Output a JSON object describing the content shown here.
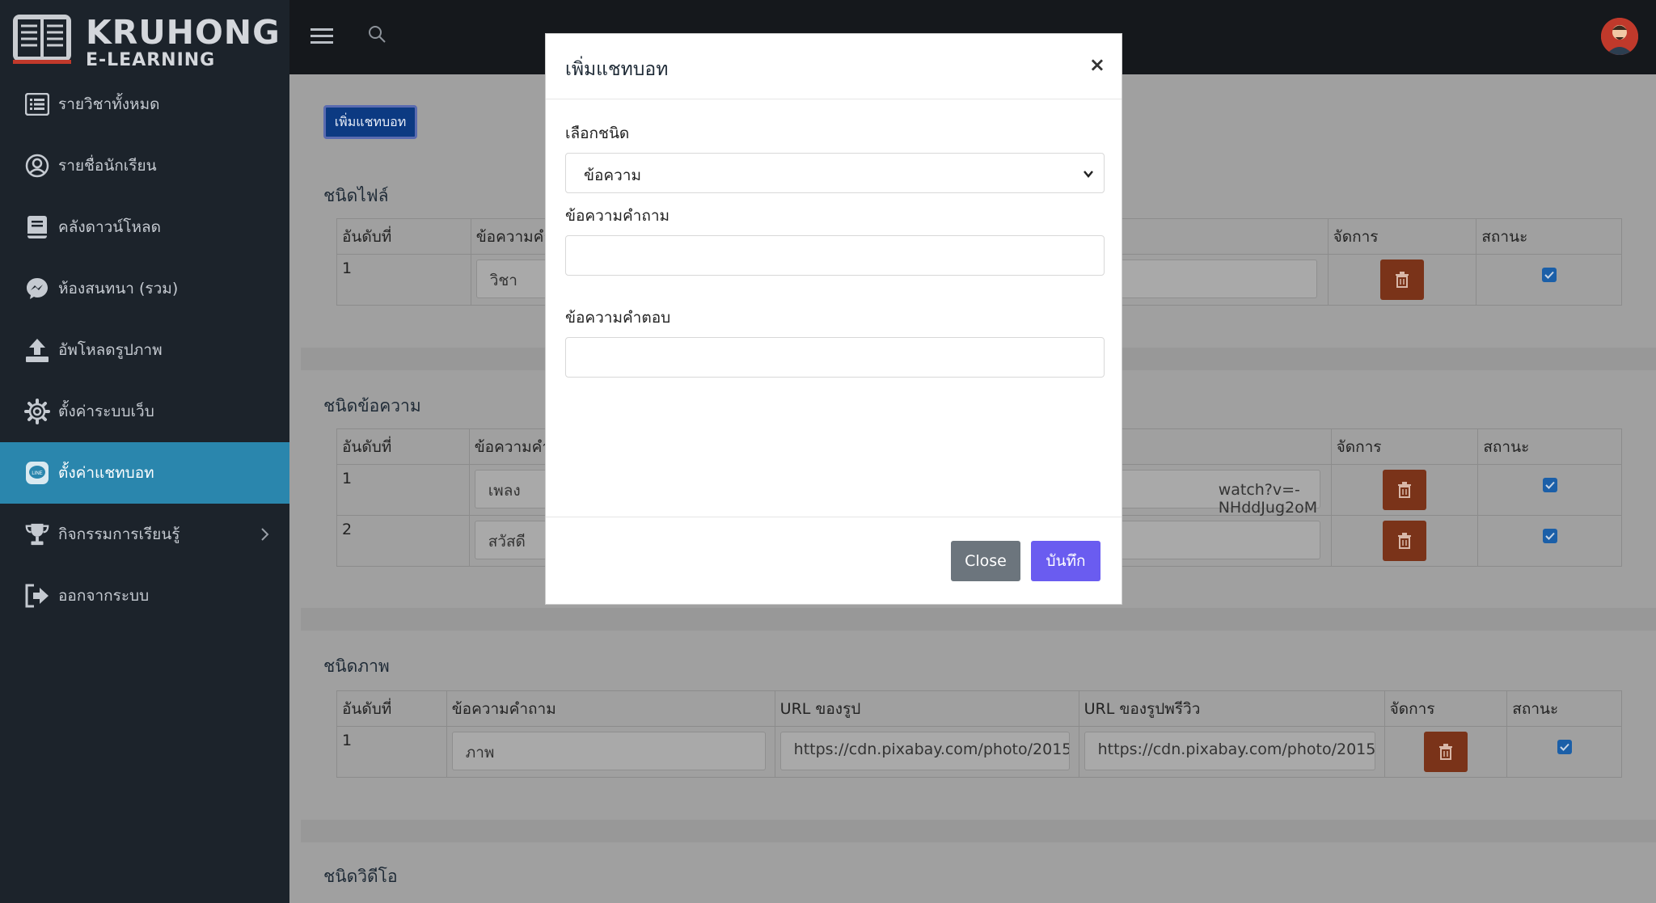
{
  "brand": {
    "name": "KRUHONG",
    "tagline": "E-LEARNING"
  },
  "sidebar": {
    "items": [
      {
        "label": "รายวิชาทั้งหมด",
        "icon": "list-icon"
      },
      {
        "label": "รายชื่อนักเรียน",
        "icon": "user-circle-icon"
      },
      {
        "label": "คลังดาวน์โหลด",
        "icon": "book-icon"
      },
      {
        "label": "ห้องสนทนา (รวม)",
        "icon": "messenger-icon"
      },
      {
        "label": "อัพโหลดรูปภาพ",
        "icon": "upload-icon"
      },
      {
        "label": "ตั้งค่าระบบเว็บ",
        "icon": "gear-icon"
      },
      {
        "label": "ตั้งค่าแชทบอท",
        "icon": "line-chat-icon",
        "active": true
      },
      {
        "label": "กิจกรรมการเรียนรู้",
        "icon": "trophy-icon",
        "has_children": true
      },
      {
        "label": "ออกจากระบบ",
        "icon": "logout-icon"
      }
    ]
  },
  "main": {
    "add_button": "เพิ่มแชทบอท",
    "sections": {
      "file": {
        "title": "ชนิดไฟล์",
        "headers": [
          "อันดับที่",
          "ข้อความคำ",
          "จัดการ",
          "สถานะ"
        ],
        "rows": [
          {
            "no": "1",
            "question": "วิชา"
          }
        ]
      },
      "text": {
        "title": "ชนิดข้อความ",
        "headers": [
          "อันดับที่",
          "ข้อความคำ",
          "จัดการ",
          "สถานะ"
        ],
        "rows": [
          {
            "no": "1",
            "question": "เพลง",
            "answer": "watch?v=-NHddJug2oM"
          },
          {
            "no": "2",
            "question": "สวัสดี",
            "answer": ""
          }
        ]
      },
      "image": {
        "title": "ชนิดภาพ",
        "headers": [
          "อันดับที่",
          "ข้อความคำถาม",
          "URL ของรูป",
          "URL ของรูปพรีวิว",
          "จัดการ",
          "สถานะ"
        ],
        "rows": [
          {
            "no": "1",
            "question": "ภาพ",
            "url": "https://cdn.pixabay.com/photo/2015",
            "preview": "https://cdn.pixabay.com/photo/2015"
          }
        ]
      },
      "video": {
        "title": "ชนิดวิดีโอ"
      }
    }
  },
  "modal": {
    "title": "เพิ่มแชทบอท",
    "close_symbol": "×",
    "type_label": "เลือกชนิด",
    "type_value": "ข้อความ",
    "question_label": "ข้อความคำถาม",
    "question_value": "",
    "answer_label": "ข้อความคำตอบ",
    "answer_value": "",
    "close_button": "Close",
    "save_button": "บันทึก"
  },
  "colors": {
    "sidebar_bg": "#1c232b",
    "active_item": "#2a86ad",
    "save_button": "#6a5cf0",
    "close_button": "#6c757d",
    "delete_button": "#7a3319"
  }
}
